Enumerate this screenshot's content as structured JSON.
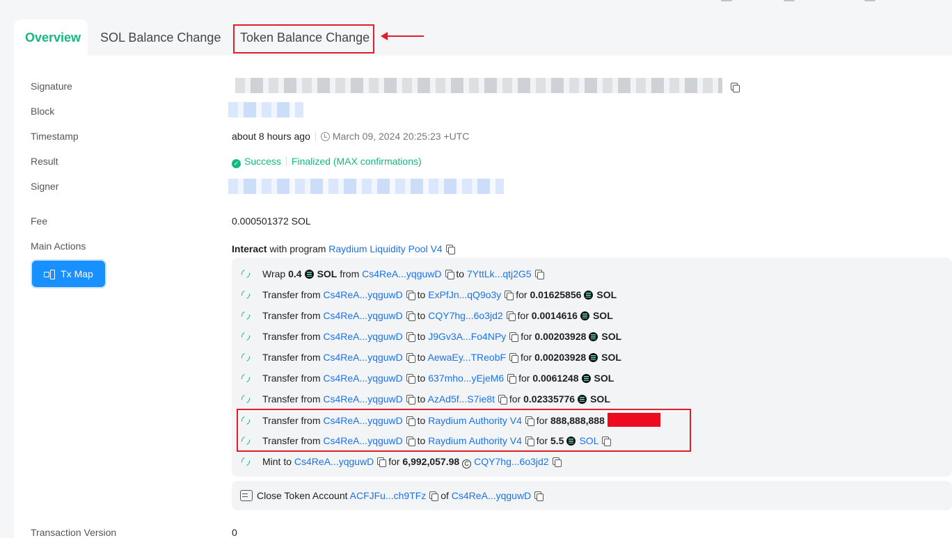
{
  "tabs": [
    {
      "label": "Overview",
      "active": true
    },
    {
      "label": "SOL Balance Change",
      "active": false
    },
    {
      "label": "Token Balance Change",
      "active": false,
      "highlighted": true
    }
  ],
  "fields": {
    "signature_label": "Signature",
    "block_label": "Block",
    "timestamp_label": "Timestamp",
    "result_label": "Result",
    "signer_label": "Signer",
    "fee_label": "Fee",
    "main_actions_label": "Main Actions",
    "tx_version_label": "Transaction Version"
  },
  "values": {
    "time_relative": "about 8 hours ago",
    "time_absolute": "March 09, 2024 20:25:23 +UTC",
    "result_status": "Success",
    "result_confirmation": "Finalized (MAX confirmations)",
    "fee": "0.000501372 SOL",
    "tx_version": "0"
  },
  "interact": {
    "prefix": "Interact",
    "with_text": "with program",
    "program": "Raydium Liquidity Pool V4"
  },
  "tx_map_label": "Tx Map",
  "actions": {
    "wrap": {
      "verb": "Wrap",
      "amount": "0.4",
      "token": "SOL",
      "from_word": "from",
      "from": "Cs4ReA...yqguwD",
      "to_word": "to",
      "to": "7YttLk...qtj2G5"
    },
    "transfers": [
      {
        "from": "Cs4ReA...yqguwD",
        "to": "ExPfJn...qQ9o3y",
        "amount": "0.01625856",
        "token": "SOL"
      },
      {
        "from": "Cs4ReA...yqguwD",
        "to": "CQY7hg...6o3jd2",
        "amount": "0.0014616",
        "token": "SOL"
      },
      {
        "from": "Cs4ReA...yqguwD",
        "to": "J9Gv3A...Fo4NPy",
        "amount": "0.00203928",
        "token": "SOL"
      },
      {
        "from": "Cs4ReA...yqguwD",
        "to": "AewaEy...TReobF",
        "amount": "0.00203928",
        "token": "SOL"
      },
      {
        "from": "Cs4ReA...yqguwD",
        "to": "637mho...yEjeM6",
        "amount": "0.0061248",
        "token": "SOL"
      },
      {
        "from": "Cs4ReA...yqguwD",
        "to": "AzAd5f...S7ie8t",
        "amount": "0.02335776",
        "token": "SOL"
      },
      {
        "from": "Cs4ReA...yqguwD",
        "to": "Raydium Authority V4",
        "amount": "888,888,888",
        "token": ""
      },
      {
        "from": "Cs4ReA...yqguwD",
        "to": "Raydium Authority V4",
        "amount": "5.5",
        "token": "SOL"
      }
    ],
    "transfer_word": "Transfer from",
    "to_word": "to",
    "for_word": "for",
    "mint": {
      "verb": "Mint to",
      "to": "Cs4ReA...yqguwD",
      "for_word": "for",
      "amount": "6,992,057.98",
      "token": "CQY7hg...6o3jd2"
    },
    "close": {
      "verb": "Close Token Account",
      "account": "ACFJFu...ch9TFz",
      "of_word": "of",
      "owner": "Cs4ReA...yqguwD"
    }
  },
  "colors": {
    "accent_green": "#12b981",
    "link_blue": "#1a73e8",
    "highlight_red": "#e11d2a",
    "button_blue": "#1890ff"
  }
}
